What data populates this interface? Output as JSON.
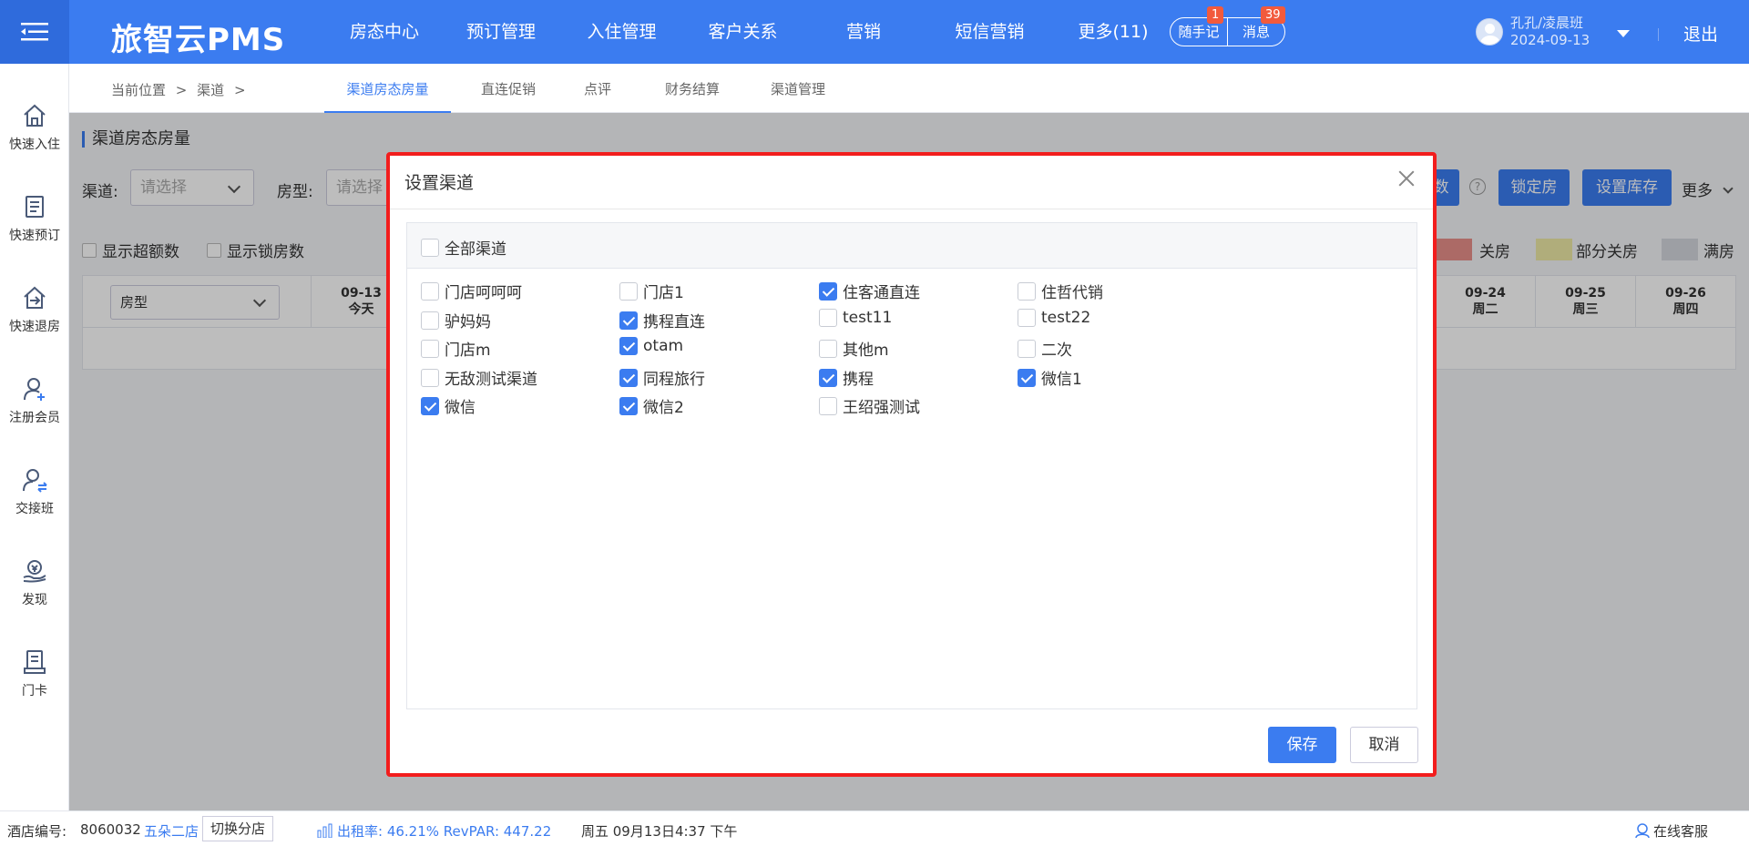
{
  "header": {
    "logo": "旅智云PMS",
    "nav": [
      {
        "label": "房态中心"
      },
      {
        "label": "预订管理"
      },
      {
        "label": "入住管理"
      },
      {
        "label": "客户关系"
      },
      {
        "label": "营销"
      },
      {
        "label": "短信营销"
      },
      {
        "label": "更多(11)"
      }
    ],
    "memo_label": "随手记",
    "memo_badge": "1",
    "msg_label": "消息",
    "msg_badge": "39",
    "user_name": "孔孔/凌晨班",
    "user_date": "2024-09-13",
    "logout": "退出"
  },
  "sidebar": [
    {
      "label": "快速入住",
      "icon": "home-icon"
    },
    {
      "label": "快速预订",
      "icon": "document-icon"
    },
    {
      "label": "快速退房",
      "icon": "checkout-icon"
    },
    {
      "label": "注册会员",
      "icon": "user-add-icon"
    },
    {
      "label": "交接班",
      "icon": "user-swap-icon"
    },
    {
      "label": "发现",
      "icon": "money-hand-icon"
    },
    {
      "label": "门卡",
      "icon": "card-icon"
    }
  ],
  "breadcrumb": {
    "current": "当前位置",
    "sep1": ">",
    "channel": "渠道",
    "sep2": ">"
  },
  "subtabs": [
    {
      "label": "渠道房态房量",
      "active": true
    },
    {
      "label": "直连促销"
    },
    {
      "label": "点评"
    },
    {
      "label": "财务结算"
    },
    {
      "label": "渠道管理"
    }
  ],
  "page": {
    "title": "渠道房态房量",
    "channel_label": "渠道:",
    "channel_placeholder": "请选择",
    "room_label": "房型:",
    "room_placeholder": "请选择",
    "show_overbook": "显示超额数",
    "show_locked": "显示锁房数",
    "btn_partial": "数",
    "btn_lock": "锁定房",
    "btn_stock": "设置库存",
    "more": "更多",
    "legend": [
      {
        "label": "关房",
        "color": "#e8908a"
      },
      {
        "label": "部分关房",
        "color": "#eeeaa6"
      },
      {
        "label": "满房",
        "color": "#d4d7dd"
      }
    ],
    "room_type": "房型",
    "days": [
      {
        "date": "09-13",
        "weekday": "今天"
      },
      {
        "date": "09-24",
        "weekday": "周二"
      },
      {
        "date": "09-25",
        "weekday": "周三"
      },
      {
        "date": "09-26",
        "weekday": "周四"
      }
    ]
  },
  "status": {
    "hotel_label": "酒店编号:",
    "hotel_no": "8060032",
    "branch": "五朵二店",
    "switch": "切换分店",
    "occupancy": "出租率: 46.21% RevPAR: 447.22",
    "datetime": "周五 09月13日4:37 下午",
    "service": "在线客服"
  },
  "modal": {
    "title": "设置渠道",
    "all_label": "全部渠道",
    "all_checked": false,
    "channels": [
      {
        "label": "门店呵呵呵",
        "checked": false
      },
      {
        "label": "门店1",
        "checked": false
      },
      {
        "label": "住客通直连",
        "checked": true
      },
      {
        "label": "住哲代销",
        "checked": false
      },
      {
        "label": "驴妈妈",
        "checked": false
      },
      {
        "label": "携程直连",
        "checked": true
      },
      {
        "label": "test11",
        "checked": false
      },
      {
        "label": "test22",
        "checked": false
      },
      {
        "label": "门店m",
        "checked": false
      },
      {
        "label": "otam",
        "checked": true
      },
      {
        "label": "其他m",
        "checked": false
      },
      {
        "label": "二次",
        "checked": false
      },
      {
        "label": "无敌测试渠道",
        "checked": false
      },
      {
        "label": "同程旅行",
        "checked": true
      },
      {
        "label": "携程",
        "checked": true
      },
      {
        "label": "微信1",
        "checked": true
      },
      {
        "label": "微信",
        "checked": true
      },
      {
        "label": "微信2",
        "checked": true
      },
      {
        "label": "王绍强测试",
        "checked": false
      }
    ],
    "save": "保存",
    "cancel": "取消"
  }
}
